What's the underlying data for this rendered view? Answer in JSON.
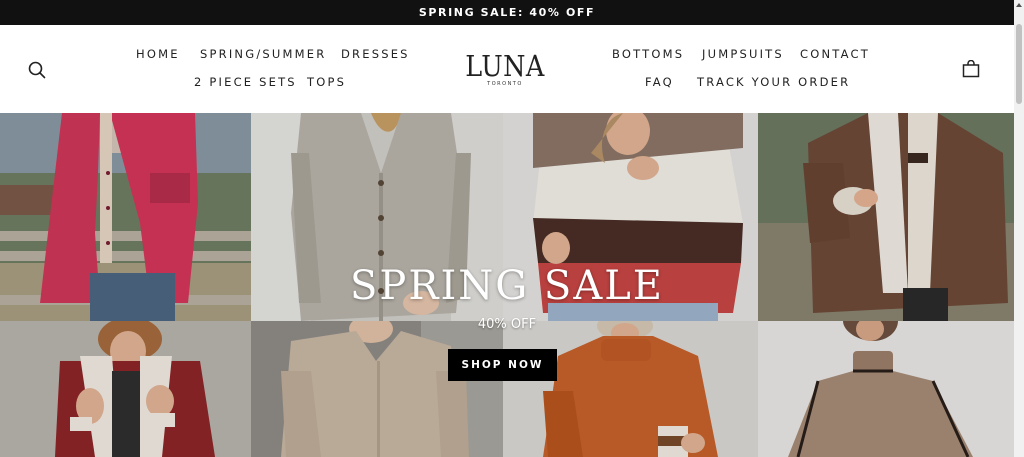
{
  "announcement": {
    "text": "SPRING SALE: 40% OFF"
  },
  "header": {
    "logo": {
      "name": "LUNA",
      "location": "TORONTO"
    },
    "nav_left_row1": [
      "HOME",
      "SPRING/SUMMER",
      "DRESSES"
    ],
    "nav_left_row2": [
      "2 PIECE SETS",
      "TOPS"
    ],
    "nav_right_row1": [
      "BOTTOMS",
      "JUMPSUITS",
      "CONTACT"
    ],
    "nav_right_row2": [
      "FAQ",
      "TRACK YOUR ORDER"
    ],
    "icons": {
      "search": "search-icon",
      "cart": "shopping-bag-icon"
    }
  },
  "hero": {
    "title": "SPRING SALE",
    "subtitle": "40% OFF",
    "cta": "SHOP NOW"
  },
  "colors": {
    "announcement_bg": "#111111",
    "text": "#222222",
    "button_bg": "#000000"
  }
}
